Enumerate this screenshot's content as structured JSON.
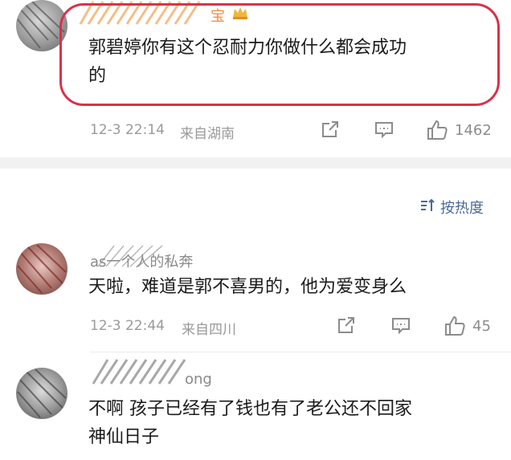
{
  "comments": [
    {
      "username": "宝",
      "badge_icon": "crown-badge-icon",
      "text_line1": "郭碧婷你有这个忍耐力你做什么都会成功",
      "text_line2": "的",
      "date": "12-3 22:14",
      "source": "来自湖南",
      "likes": "1462"
    },
    {
      "username": "as一个人的私奔",
      "text": "天啦，难道是郭不喜男的，他为爱变身么",
      "date": "12-3 22:44",
      "source": "来自四川",
      "likes": "45"
    },
    {
      "username": "ong",
      "text_line1": "不啊 孩子已经有了钱也有了老公还不回家",
      "text_line2": "神仙日子"
    }
  ],
  "sort": {
    "label": "按热度",
    "icon": "sort-icon"
  },
  "colors": {
    "highlight": "#d9324a",
    "link": "#4a6b96",
    "meta": "#9a9a9a"
  }
}
